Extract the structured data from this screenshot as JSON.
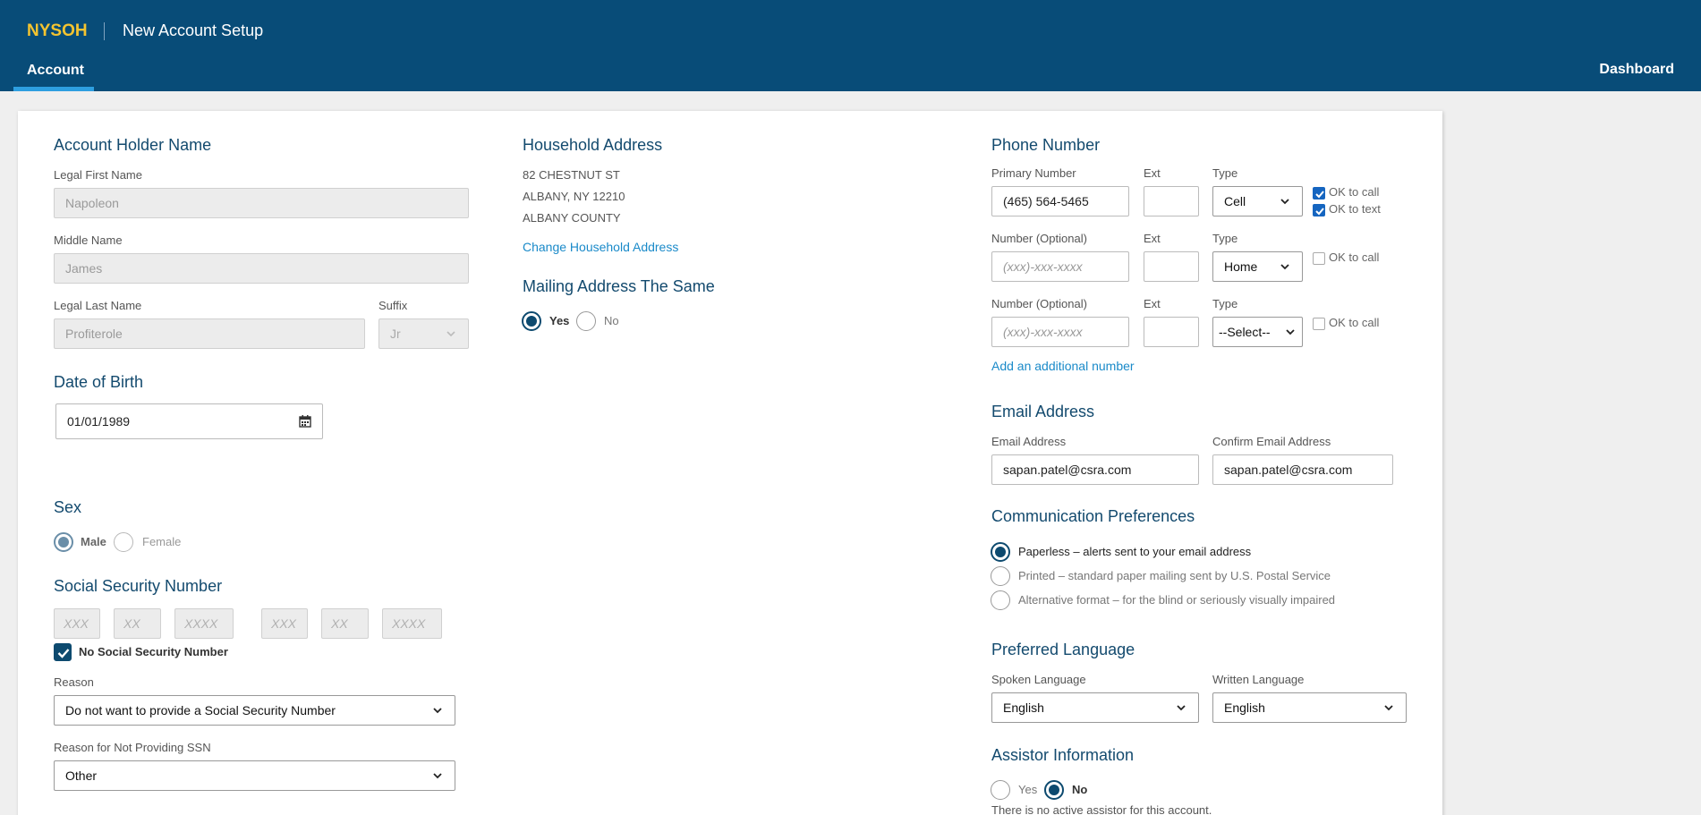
{
  "header": {
    "logo": "NYSOH",
    "title": "New Account Setup",
    "tab_account": "Account",
    "dashboard": "Dashboard"
  },
  "account_holder": {
    "heading": "Account Holder Name",
    "first_label": "Legal First Name",
    "first_value": "Napoleon",
    "middle_label": "Middle Name",
    "middle_value": "James",
    "last_label": "Legal Last Name",
    "last_value": "Profiterole",
    "suffix_label": "Suffix",
    "suffix_value": "Jr"
  },
  "dob": {
    "heading": "Date of Birth",
    "value": "01/01/1989"
  },
  "sex": {
    "heading": "Sex",
    "options": [
      "Male",
      "Female"
    ],
    "selected": "Male"
  },
  "ssn": {
    "heading": "Social Security Number",
    "placeholders": [
      "XXX",
      "XX",
      "XXXX",
      "XXX",
      "XX",
      "XXXX"
    ],
    "no_ssn_label": "No Social Security Number",
    "no_ssn_checked": true,
    "reason_label": "Reason",
    "reason_value": "Do not want to provide a Social Security Number",
    "reason2_label": "Reason for Not Providing SSN",
    "reason2_value": "Other"
  },
  "household": {
    "heading": "Household Address",
    "line1": "82 CHESTNUT ST",
    "line2": "ALBANY, NY 12210",
    "line3": "ALBANY COUNTY",
    "change_link": "Change Household Address"
  },
  "mailing": {
    "heading": "Mailing Address The Same",
    "yes": "Yes",
    "no": "No",
    "selected": "Yes"
  },
  "phone": {
    "heading": "Phone Number",
    "rows": [
      {
        "label": "Primary Number",
        "value": "(465) 564-5465",
        "placeholder": "",
        "ext_label": "Ext",
        "type_label": "Type",
        "type": "Cell"
      },
      {
        "label": "Number (Optional)",
        "value": "",
        "placeholder": "(xxx)-xxx-xxxx",
        "ext_label": "Ext",
        "type_label": "Type",
        "type": "Home"
      },
      {
        "label": "Number (Optional)",
        "value": "",
        "placeholder": "(xxx)-xxx-xxxx",
        "ext_label": "Ext",
        "type_label": "Type",
        "type": "--Select--"
      }
    ],
    "ok_call": "OK to call",
    "ok_text": "OK to text",
    "add_link": "Add an additional number"
  },
  "email": {
    "heading": "Email Address",
    "label": "Email Address",
    "value": "sapan.patel@csra.com",
    "confirm_label": "Confirm Email Address",
    "confirm_value": "sapan.patel@csra.com"
  },
  "comm": {
    "heading": "Communication Preferences",
    "options": [
      "Paperless – alerts sent to your email address",
      "Printed – standard paper mailing sent by U.S. Postal Service",
      "Alternative format – for the blind or seriously visually impaired"
    ],
    "selected": 0
  },
  "language": {
    "heading": "Preferred Language",
    "spoken_label": "Spoken Language",
    "spoken_value": "English",
    "written_label": "Written Language",
    "written_value": "English"
  },
  "assistor": {
    "heading": "Assistor Information",
    "yes": "Yes",
    "no": "No",
    "selected": "No",
    "note": "There is no active assistor for this account."
  },
  "colors": {
    "header": "#084c78",
    "accent_tab": "#2e9fe0",
    "logo": "#f4c430",
    "heading": "#134a6e",
    "link": "#1a8ac9"
  }
}
